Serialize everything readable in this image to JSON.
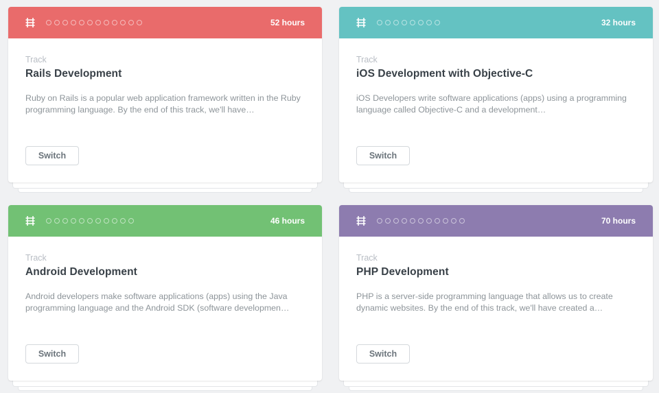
{
  "cards": [
    {
      "color": "#e96b6b",
      "dots": 12,
      "hours": "52 hours",
      "kicker": "Track",
      "title": "Rails Development",
      "description": "Ruby on Rails is a popular web application framework written in the Ruby programming language. By the end of this track, we'll have…",
      "button": "Switch"
    },
    {
      "color": "#64c2c2",
      "dots": 8,
      "hours": "32 hours",
      "kicker": "Track",
      "title": "iOS Development with Objective-C",
      "description": "iOS Developers write software applications (apps) using a programming language called Objective-C and a development…",
      "button": "Switch"
    },
    {
      "color": "#72c174",
      "dots": 11,
      "hours": "46 hours",
      "kicker": "Track",
      "title": "Android Development",
      "description": "Android developers make software applications (apps) using the Java programming language and the Android SDK (software developmen…",
      "button": "Switch"
    },
    {
      "color": "#8d7caf",
      "dots": 11,
      "hours": "70 hours",
      "kicker": "Track",
      "title": "PHP Development",
      "description": "PHP is a server-side programming language that allows us to create dynamic websites. By the end of this track, we'll have created a…",
      "button": "Switch"
    }
  ],
  "icon": "track-rail-icon"
}
